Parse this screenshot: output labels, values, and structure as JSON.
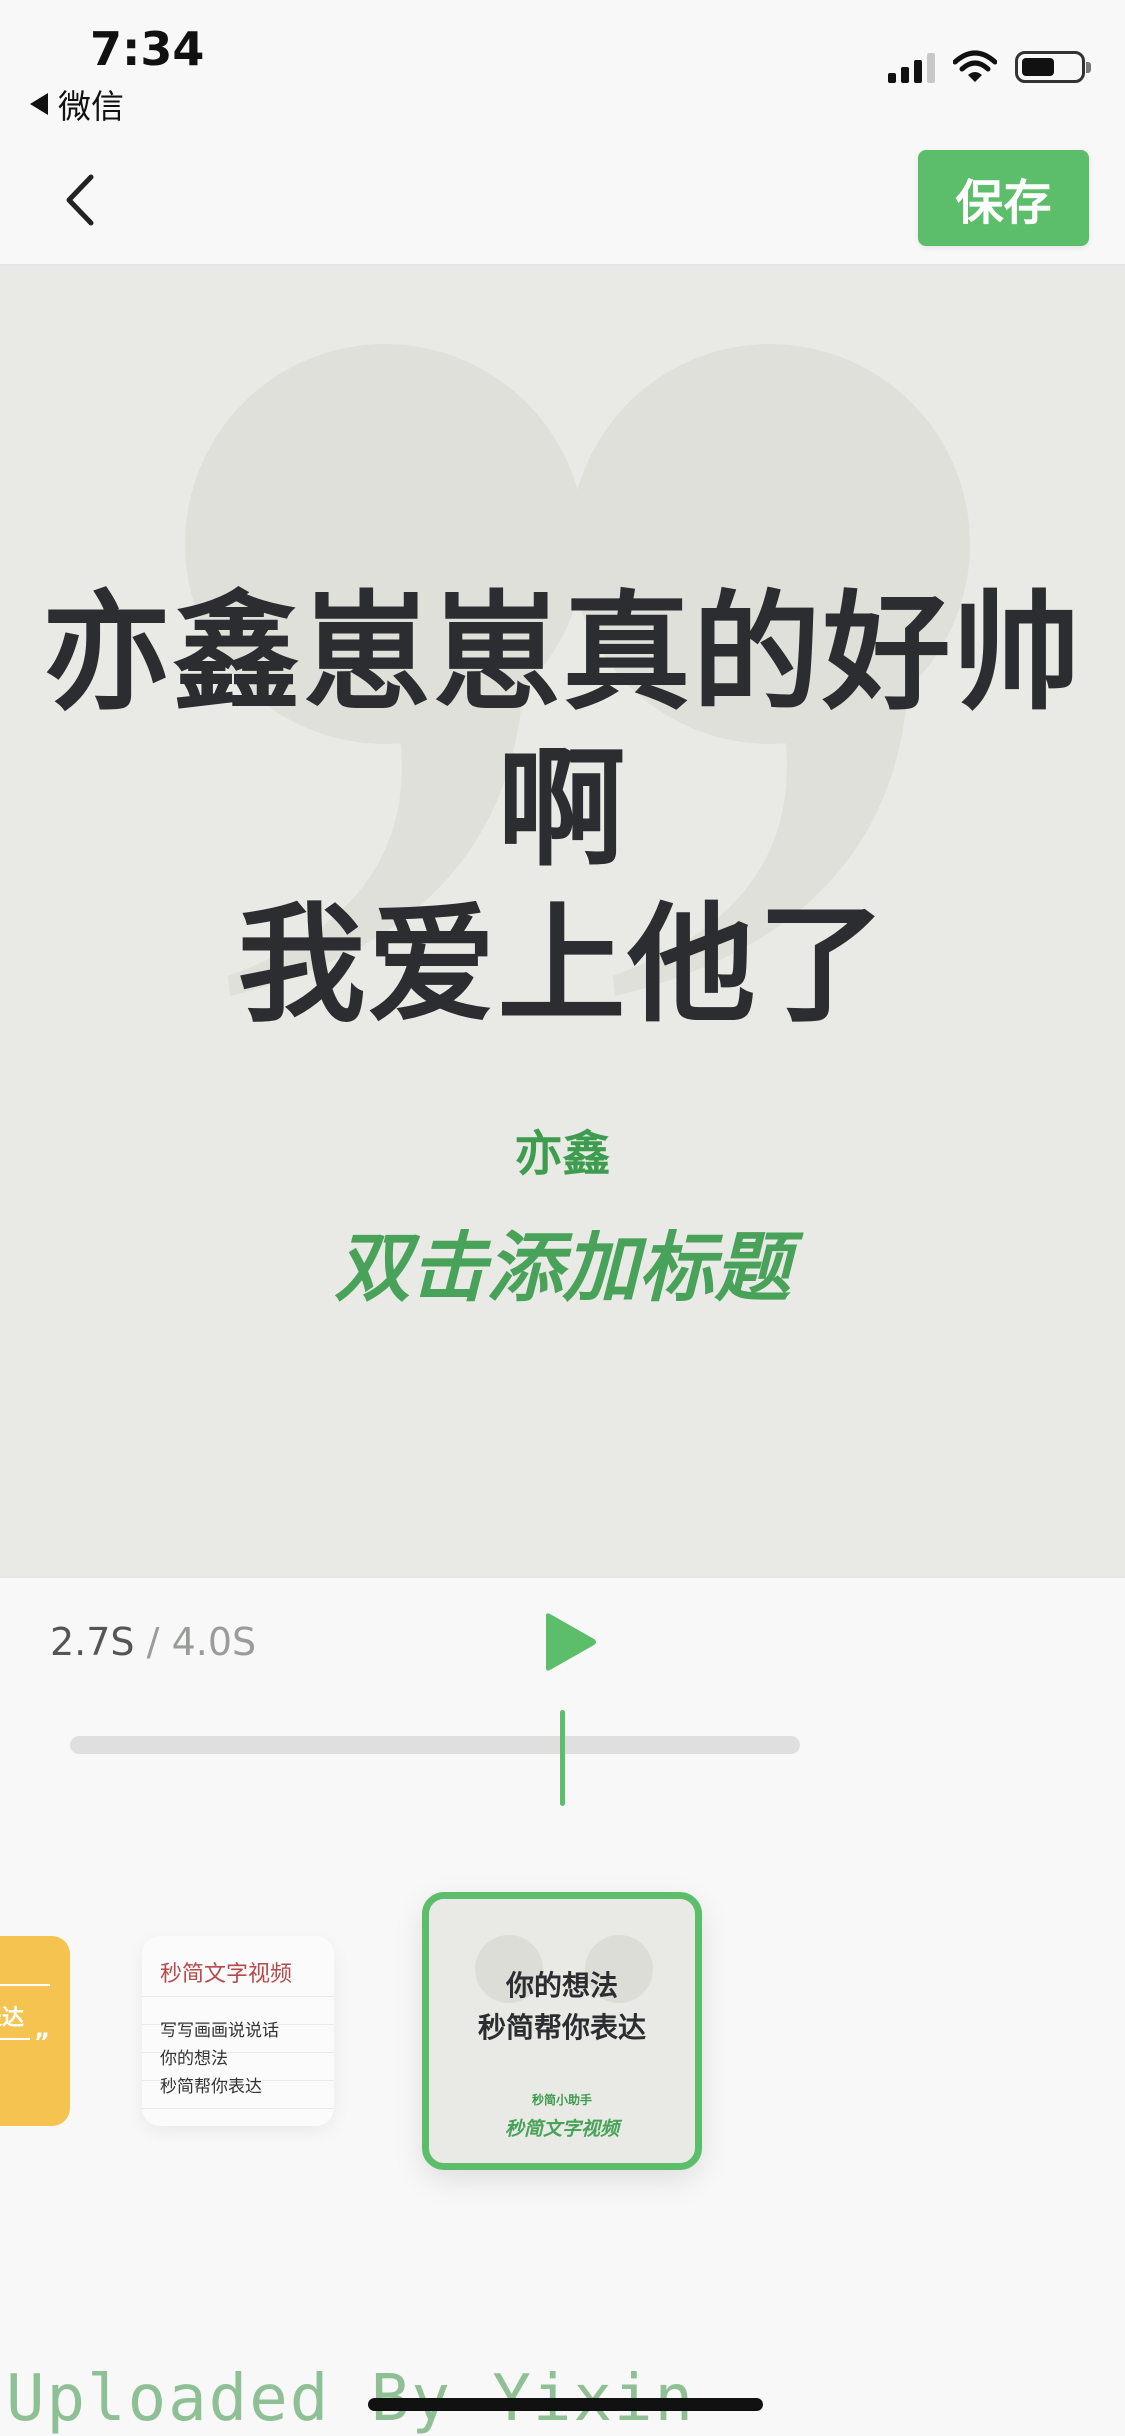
{
  "status_bar": {
    "time": "7:34",
    "back_app_label": "微信"
  },
  "nav": {
    "save_label": "保存"
  },
  "preview": {
    "headline_line1": "亦鑫崽崽真的好帅啊",
    "headline_line2": "我爱上他了",
    "author": "亦鑫",
    "title_hint": "双击添加标题"
  },
  "player": {
    "current_time": "2.7S",
    "separator": "/",
    "total_time": "4.0S",
    "progress_fraction": 0.675
  },
  "templates": [
    {
      "name": "yellow",
      "text_fragment": "表达"
    },
    {
      "name": "handwritten",
      "title": "秒简文字视频",
      "lines": [
        "写写画画说说话",
        "你的想法",
        "秒简帮你表达"
      ]
    },
    {
      "name": "quote",
      "headline_line1": "你的想法",
      "headline_line2": "秒简帮你表达",
      "author": "秒简小助手",
      "title": "秒简文字视频"
    }
  ],
  "watermark": "Uploaded By Yixin",
  "colors": {
    "accent": "#5cbd6a",
    "preview_bg": "#e9eae5",
    "headline": "#2b2d30",
    "author": "#3e9c4f",
    "template_yellow": "#f5c34f"
  },
  "icons": {
    "back": "chevron-left-icon",
    "play": "play-icon",
    "quote": "closing-quote-icon"
  }
}
